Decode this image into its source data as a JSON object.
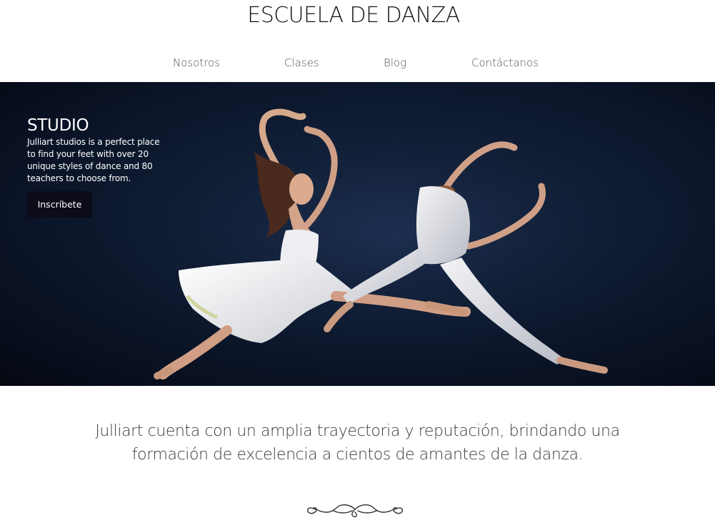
{
  "header": {
    "title": "ESCUELA DE DANZA"
  },
  "nav": {
    "items": [
      {
        "label": "Nosotros"
      },
      {
        "label": "Clases"
      },
      {
        "label": "Blog"
      },
      {
        "label": "Contáctanos"
      }
    ]
  },
  "hero": {
    "heading": "STUDIO",
    "description": "Julliart studios is a perfect place to find your feet with over 20 unique styles of dance and 80 teachers to choose from.",
    "button_label": "Inscríbete"
  },
  "intro": {
    "text": "Julliart cuenta con un amplia trayectoria y reputación, brindando una formación de excelencia a cientos de amantes de la danza."
  },
  "colors": {
    "hero_background": "#0f1d36",
    "button_background": "#0b0c18",
    "text_dark": "#222222"
  },
  "icons": {
    "divider": "ornamental-flourish-icon"
  }
}
